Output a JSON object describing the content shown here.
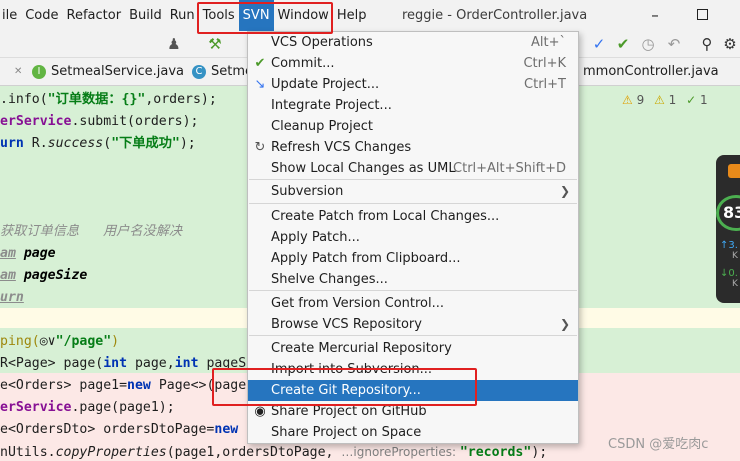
{
  "menubar": {
    "items": [
      "ile",
      "Code",
      "Refactor",
      "Build",
      "Run",
      "Tools",
      "SVN",
      "Window",
      "Help"
    ],
    "active_index": 6,
    "window_title": "reggie - OrderController.java",
    "minimize_label": "–"
  },
  "tabs": [
    {
      "label": "SetmealService.java",
      "icon_letter": "I",
      "icon_color": "#62b543"
    },
    {
      "label": "Setme",
      "icon_letter": "C",
      "icon_color": "#3592c4"
    },
    {
      "label": "mmonController.java",
      "icon_letter": "",
      "icon_color": ""
    }
  ],
  "inspections": {
    "warnings": "9",
    "weak": "1",
    "typos": "1"
  },
  "code_lines": [
    {
      "parts": [
        [
          "",
          ".info("
        ],
        [
          "str",
          "\"订单数据：{}\""
        ],
        [
          "",
          ",orders);"
        ]
      ]
    },
    {
      "parts": [
        [
          "fld",
          "erService"
        ],
        [
          "",
          ".submit(orders);"
        ]
      ]
    },
    {
      "parts": [
        [
          "kw",
          "urn "
        ],
        [
          "",
          "R."
        ],
        [
          "it",
          "success"
        ],
        [
          "",
          "("
        ],
        [
          "str",
          "\"下单成功\""
        ],
        [
          "",
          ");"
        ]
      ]
    },
    {
      "parts": [
        [
          "com",
          "获取订单信息   用户名没解决"
        ]
      ]
    },
    {
      "parts": [
        [
          "tag",
          "am"
        ],
        [
          "",
          " "
        ],
        [
          "param",
          "page"
        ]
      ]
    },
    {
      "parts": [
        [
          "tag",
          "am"
        ],
        [
          "",
          " "
        ],
        [
          "param",
          "pageSize"
        ]
      ]
    },
    {
      "parts": [
        [
          "tag",
          "urn"
        ]
      ]
    },
    {
      "parts": [
        [
          "ann",
          "ping("
        ],
        [
          "",
          "◎∨"
        ],
        [
          "str",
          "\"/page\""
        ],
        [
          "ann",
          ")"
        ]
      ]
    },
    {
      "parts": [
        [
          "",
          "R<Page> page("
        ],
        [
          "kw",
          "int "
        ],
        [
          "",
          "page,"
        ],
        [
          "kw",
          "int "
        ],
        [
          "",
          "pageSi"
        ]
      ]
    },
    {
      "parts": [
        [
          "",
          "e<Orders> page1="
        ],
        [
          "kw",
          "new "
        ],
        [
          "",
          "Page<>(page"
        ]
      ]
    },
    {
      "parts": [
        [
          "fld",
          "erService"
        ],
        [
          "",
          ".page(page1);"
        ]
      ]
    },
    {
      "parts": [
        [
          "",
          "e<OrdersDto> ordersDtoPage="
        ],
        [
          "kw",
          "new "
        ],
        [
          "",
          "I"
        ]
      ]
    },
    {
      "parts": [
        [
          "",
          "nUtils."
        ],
        [
          "it",
          "copyProperties"
        ],
        [
          "",
          "(page1,ordersDtoPage, "
        ],
        [
          "hint",
          "…ignoreProperties: "
        ],
        [
          "str",
          "\"records\""
        ],
        [
          "",
          ");"
        ]
      ]
    }
  ],
  "svn_menu": {
    "items": [
      {
        "label": "VCS Operations",
        "shortcut": "Alt+`",
        "icon": "",
        "submenu": false
      },
      {
        "label": "Commit...",
        "shortcut": "Ctrl+K",
        "icon": "check-icon",
        "submenu": false
      },
      {
        "label": "Update Project...",
        "shortcut": "Ctrl+T",
        "icon": "update-icon",
        "submenu": false
      },
      {
        "label": "Integrate Project...",
        "shortcut": "",
        "icon": "",
        "submenu": false
      },
      {
        "label": "Cleanup Project",
        "shortcut": "",
        "icon": "",
        "submenu": false
      },
      {
        "label": "Refresh VCS Changes",
        "shortcut": "",
        "icon": "refresh-icon",
        "submenu": false
      },
      {
        "label": "Show Local Changes as UML",
        "shortcut": "Ctrl+Alt+Shift+D",
        "icon": "",
        "submenu": false
      },
      {
        "label": "Subversion",
        "shortcut": "",
        "icon": "",
        "submenu": true
      },
      {
        "label": "Create Patch from Local Changes...",
        "shortcut": "",
        "icon": "",
        "submenu": false
      },
      {
        "label": "Apply Patch...",
        "shortcut": "",
        "icon": "",
        "submenu": false
      },
      {
        "label": "Apply Patch from Clipboard...",
        "shortcut": "",
        "icon": "",
        "submenu": false
      },
      {
        "label": "Shelve Changes...",
        "shortcut": "",
        "icon": "",
        "submenu": false
      },
      {
        "label": "Get from Version Control...",
        "shortcut": "",
        "icon": "",
        "submenu": false
      },
      {
        "label": "Browse VCS Repository",
        "shortcut": "",
        "icon": "",
        "submenu": true
      },
      {
        "label": "Create Mercurial Repository",
        "shortcut": "",
        "icon": "",
        "submenu": false
      },
      {
        "label": "Import into Subversion...",
        "shortcut": "",
        "icon": "",
        "submenu": false
      },
      {
        "label": "Create Git Repository...",
        "shortcut": "",
        "icon": "",
        "submenu": false,
        "selected": true
      },
      {
        "label": "Share Project on GitHub",
        "shortcut": "",
        "icon": "github-icon",
        "submenu": false
      },
      {
        "label": "Share Project on Space",
        "shortcut": "",
        "icon": "",
        "submenu": false
      }
    ]
  },
  "widget": {
    "value": "83",
    "up": "3.",
    "up_unit": "K",
    "down": "0.",
    "down_unit": "K"
  },
  "watermark": "CSDN @爱吃肉c",
  "colors": {
    "accent": "#2675bf",
    "highlight_box": "#e02020",
    "green_band": "#d7f0d5",
    "pink_band": "#fce8e6"
  }
}
